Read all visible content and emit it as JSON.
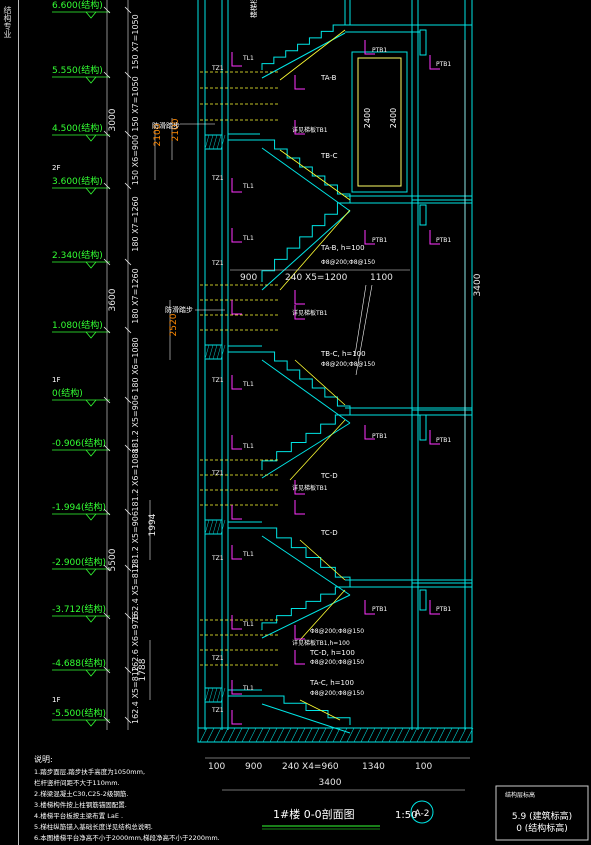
{
  "side_tab": {
    "label": "结构专业"
  },
  "elevations": [
    {
      "value": "6.600(结构)",
      "floor": ""
    },
    {
      "value": "5.550(结构)",
      "floor": ""
    },
    {
      "value": "4.500(结构)",
      "floor": ""
    },
    {
      "value": "3.600(结构)",
      "floor": "2F"
    },
    {
      "value": "2.340(结构)",
      "floor": ""
    },
    {
      "value": "1.080(结构)",
      "floor": ""
    },
    {
      "value": "0(结构)",
      "floor": "1F"
    },
    {
      "value": "-0.906(结构)",
      "floor": ""
    },
    {
      "value": "-1.994(结构)",
      "floor": ""
    },
    {
      "value": "-2.900(结构)",
      "floor": ""
    },
    {
      "value": "-3.712(结构)",
      "floor": ""
    },
    {
      "value": "-4.688(结构)",
      "floor": ""
    },
    {
      "value": "-5.500(结构)",
      "floor": "1F"
    }
  ],
  "vertical_dims": {
    "totals": [
      "3000",
      "3600",
      "5500"
    ],
    "steps": [
      "150 X7=1050",
      "150 X7=1050",
      "150 X6=900",
      "180 X7=1260",
      "180 X7=1260",
      "180 X6=1080",
      "181.2 X5=906",
      "181.2 X6=1088",
      "181.2 X5=906",
      "162.4 X5=812",
      "162.6 X6=976",
      "162.4 X5=812"
    ],
    "inner": [
      "2100",
      "2100",
      "2520",
      "1994",
      "1788"
    ]
  },
  "right_dim": "3400",
  "bottom_dims": {
    "segments": [
      "100",
      "900",
      "240 X4=960",
      "1340",
      "100"
    ],
    "total": "3400"
  },
  "mid_dims": {
    "left": "900",
    "steps": "240 X5=1200",
    "right": "1100"
  },
  "window_dims": [
    "2400",
    "2400"
  ],
  "flights": [
    "TA-B",
    "TB-C",
    "TA-B, h=100",
    "TB-C, h=100",
    "TC-D",
    "TC-D",
    "TC-D, h=100",
    "TA-C, h=100"
  ],
  "flight_rebar": [
    "Φ8@200;Φ8@150",
    "Φ8@200;Φ8@150",
    "Φ8@200;Φ8@150",
    "Φ8@200;Φ8@150",
    "Φ8@200;Φ8@150"
  ],
  "tags": {
    "beam": "TL1",
    "column": "TZ1",
    "platform": "PTB1",
    "slab_note": "详见梯板TB1",
    "slab_note_h": "详见梯板TB1,h=100"
  },
  "callouts": [
    "防滑踏步",
    "防滑踏步",
    "楼梯栏杆"
  ],
  "title": {
    "name": "1#楼   0-0剖面图",
    "scale": "1:50",
    "index": "A-2"
  },
  "notes": {
    "heading": "说明:",
    "items": [
      "1.踏步面层,踏步扶手高度为1050mm,",
      "   栏杆竖杆间距不大于110mm.",
      "2.梯梁混凝土C30,C25-2级钢筋.",
      "3.楼梯构件按上柱钢筋锚固配置.",
      "4.楼梯平台板按主梁布置 LaE .",
      "5.梯柱纵筋锚入基础长度详见结构总说明.",
      "6.本图楼梯平台净高不小于2000mm,梯段净高不小于2200mm."
    ]
  },
  "stamp": {
    "title": "结构层标高",
    "line1": "5.9 (建筑标高)",
    "line2": "0 (结构标高)"
  },
  "colors": {
    "wall": "#00e5e5",
    "stair": "#ffff33",
    "rebar": "#ff33ff",
    "text": "#ffffff",
    "elev": "#33ff33",
    "dim": "#e8e8e8",
    "hatch": "#00cccc"
  }
}
